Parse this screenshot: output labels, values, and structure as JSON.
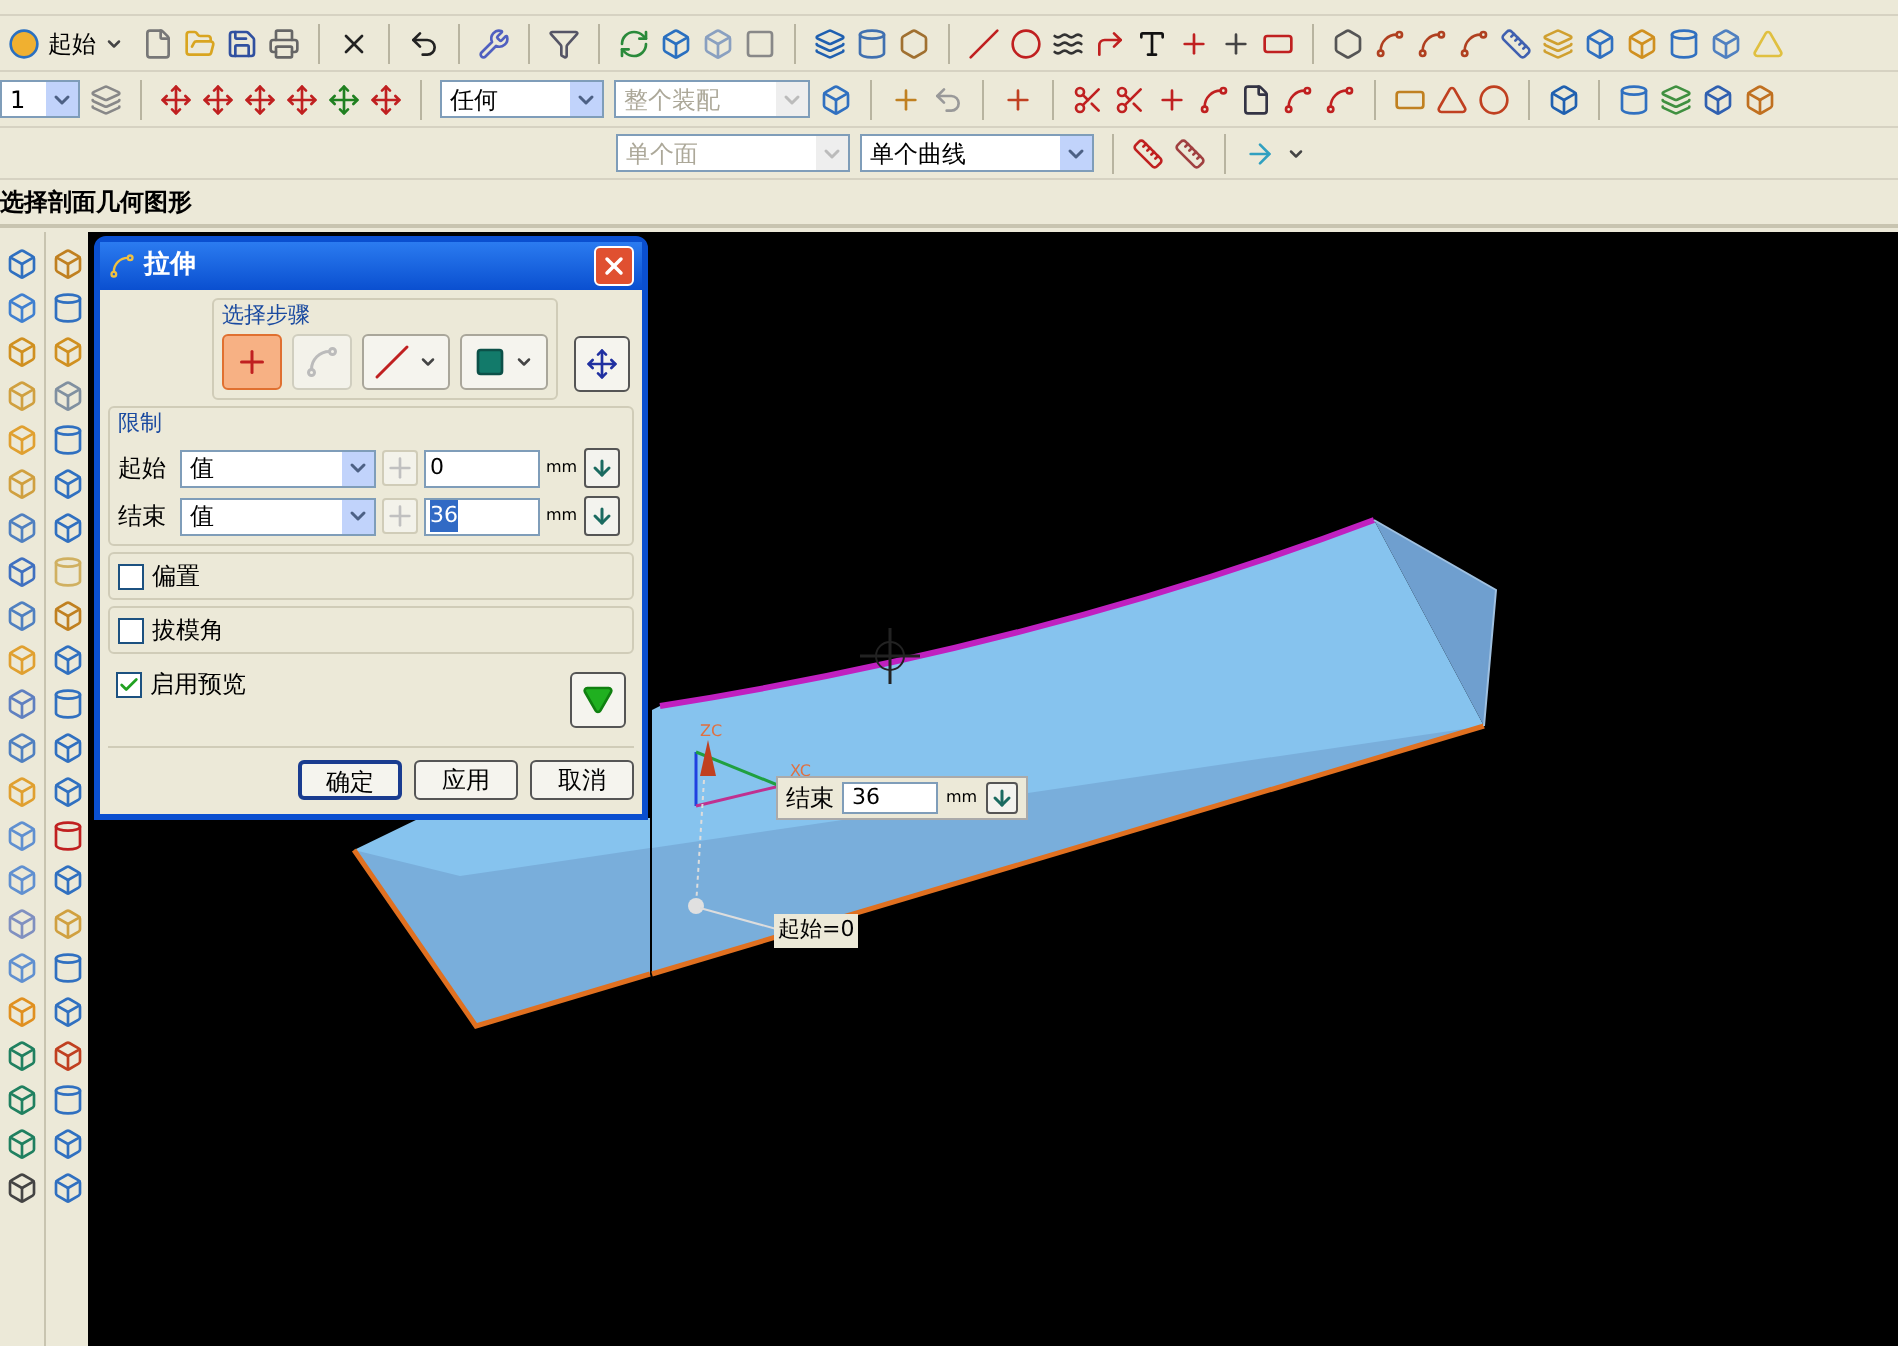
{
  "toolbar": {
    "start_button": "起始",
    "layer_select": "1",
    "filter_select": {
      "value": "任何",
      "disabled": false
    },
    "scope_select": {
      "value": "整个装配",
      "disabled": true
    },
    "face_rule_select": {
      "value": "单个面",
      "disabled": true
    },
    "curve_rule_select": {
      "value": "单个曲线",
      "disabled": false
    }
  },
  "prompt": "选择剖面几何图形",
  "dialog": {
    "title": "拉伸",
    "steps_label": "选择步骤",
    "steps": [
      {
        "kind": "section",
        "selected": true,
        "disabled": false
      },
      {
        "kind": "sketch",
        "selected": false,
        "disabled": true
      },
      {
        "kind": "direction",
        "selected": false,
        "disabled": false
      },
      {
        "kind": "body",
        "selected": false,
        "disabled": false
      }
    ],
    "limits_label": "限制",
    "limits": [
      {
        "label": "起始",
        "method": "值",
        "value": "0",
        "unit": "mm",
        "text_selected": false
      },
      {
        "label": "结束",
        "method": "值",
        "value": "36",
        "unit": "mm",
        "text_selected": true
      }
    ],
    "options": [
      {
        "label": "偏置",
        "checked": false,
        "boxed": true
      },
      {
        "label": "拔模角",
        "checked": false,
        "boxed": true
      },
      {
        "label": "启用预览",
        "checked": true,
        "boxed": false
      }
    ],
    "buttons": [
      {
        "label": "确定",
        "default": true
      },
      {
        "label": "应用",
        "default": false
      },
      {
        "label": "取消",
        "default": false
      }
    ]
  },
  "viewport": {
    "axis_labels": [
      "ZC",
      "XC"
    ],
    "end_field": {
      "label": "结束",
      "value": "36",
      "unit": "mm"
    },
    "start_label": "起始=0"
  }
}
